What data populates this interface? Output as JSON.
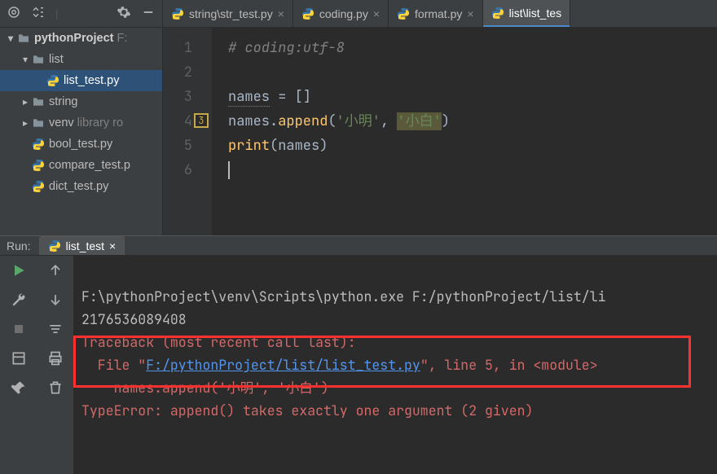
{
  "sidebar": {
    "project": "pythonProject",
    "project_root_suffix": "F:",
    "items": [
      {
        "label": "list",
        "indent": 1,
        "type": "folder",
        "expanded": true
      },
      {
        "label": "list_test.py",
        "indent": 2,
        "type": "py",
        "selected": true
      },
      {
        "label": "string",
        "indent": 1,
        "type": "folder",
        "expanded": false
      },
      {
        "label": "venv",
        "indent": 1,
        "type": "folder",
        "expanded": false,
        "dim": "library ro"
      },
      {
        "label": "bool_test.py",
        "indent": 1,
        "type": "py"
      },
      {
        "label": "compare_test.p",
        "indent": 1,
        "type": "py"
      },
      {
        "label": "dict_test.py",
        "indent": 1,
        "type": "py"
      }
    ]
  },
  "editor_tabs": [
    {
      "label": "string\\str_test.py",
      "active": false
    },
    {
      "label": "coding.py",
      "active": false
    },
    {
      "label": "format.py",
      "active": false
    },
    {
      "label": "list\\list_tes",
      "active": true
    }
  ],
  "code": {
    "lines": [
      "1",
      "2",
      "3",
      "4",
      "5",
      "6"
    ],
    "gutter_marker": {
      "line": 4,
      "text": "3"
    },
    "l1_comment": "# coding:utf-8",
    "l3_lhs": "names",
    "l3_rhs": " = []",
    "l4_obj": "names.",
    "l4_fn": "append",
    "l4_open": "(",
    "l4_s1": "'小明'",
    "l4_sep": ", ",
    "l4_s2": "'小白'",
    "l4_close": ")",
    "l5_fn": "print",
    "l5_arg": "(names)"
  },
  "run": {
    "title": "Run:",
    "tab": "list_test",
    "lines": {
      "cmd": "F:\\pythonProject\\venv\\Scripts\\python.exe F:/pythonProject/list/li",
      "id": "2176536089408",
      "tb": "Traceback (most recent call last):",
      "file_pre": "  File \"",
      "file_path": "F:/pythonProject/list/list_test.py",
      "file_post": "\", line 5, in <module>",
      "src": "    names.append('小明', '小白')",
      "err": "TypeError: append() takes exactly one argument (2 given)"
    }
  }
}
